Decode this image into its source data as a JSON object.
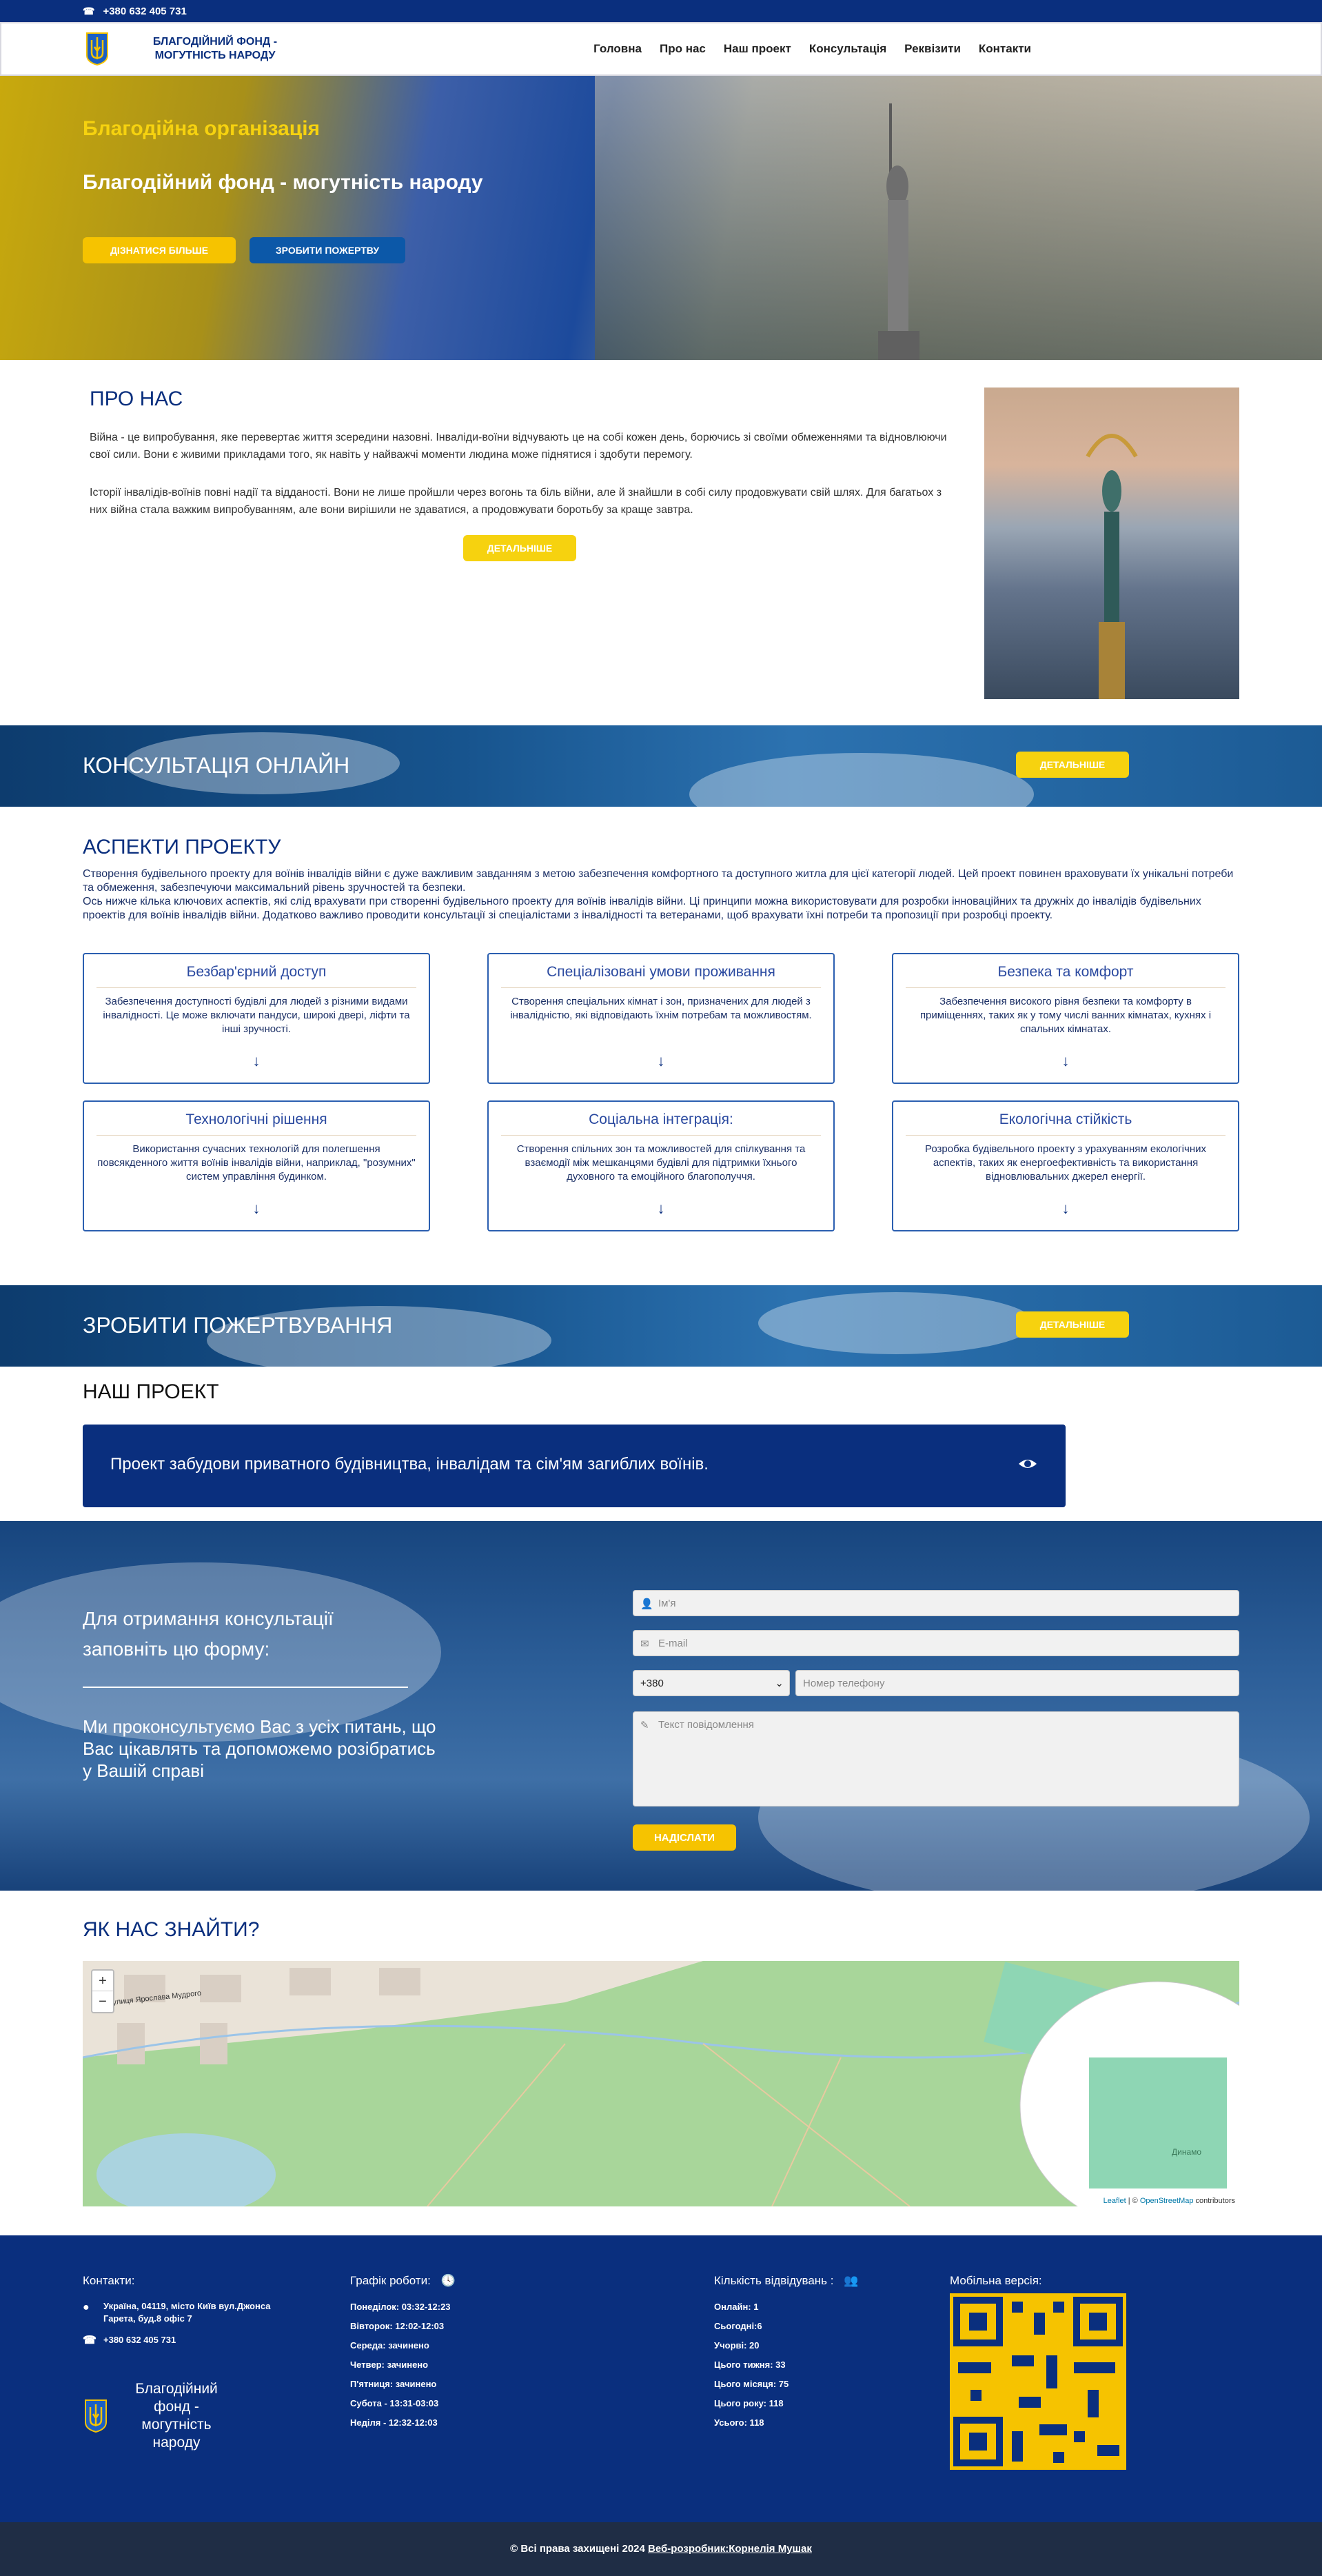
{
  "topbar": {
    "phone": "+380 632 405 731"
  },
  "header": {
    "logo_text": "БЛАГОДІЙНИЙ ФОНД - МОГУТНІСТЬ НАРОДУ",
    "nav": [
      "Головна",
      "Про нас",
      "Наш проект",
      "Консультація",
      "Реквізити",
      "Контакти"
    ]
  },
  "hero": {
    "subtitle": "Благодійна організація",
    "title": "Благодійний фонд - могутність народу",
    "btn_learn": "ДІЗНАТИСЯ БІЛЬШЕ",
    "btn_donate": "ЗРОБИТИ ПОЖЕРТВУ"
  },
  "about": {
    "title": "ПРО НАС",
    "p1": "Війна - це випробування, яке перевертає життя зсередини назовні. Інваліди-воїни відчувають це на собі кожен день, борючись зі своїми обмеженнями та відновлюючи свої сили. Вони є живими прикладами того, як навіть у найважчі моменти людина може піднятися і здобути перемогу.",
    "p2": "Історії інвалідів-воїнів повні надії та відданості. Вони не лише пройшли через вогонь та біль війни, але й знайшли в собі силу продовжувати свій шлях. Для багатьох з них війна стала важким випробуванням, але вони вирішили не здаватися, а продовжувати боротьбу за краще завтра.",
    "btn": "ДЕТАЛЬНІШЕ"
  },
  "consult_banner": {
    "title": "КОНСУЛЬТАЦІЯ ОНЛАЙН",
    "btn": "ДЕТАЛЬНІШЕ"
  },
  "aspects": {
    "title": "АСПЕКТИ ПРОЕКТУ",
    "intro1": "Створення будівельного проекту для воїнів інвалідів війни є дуже важливим завданням з метою забезпечення комфортного та доступного житла для цієї категорії людей. Цей проект повинен враховувати їх унікальні потреби та обмеження, забезпечуючи максимальний рівень зручностей та безпеки.",
    "intro2": "Ось нижче кілька ключових аспектів, які слід врахувати при створенні будівельного проекту для воїнів інвалідів війни. Ці принципи можна використовувати для розробки інноваційних та дружніх до інвалідів будівельних проектів для воїнів інвалідів війни. Додатково важливо проводити консультації зі спеціалістами з інвалідності та ветеранами, щоб врахувати їхні потреби та пропозиції при розробці проекту.",
    "cards": [
      {
        "title": "Безбар'єрний доступ",
        "desc": "Забезпечення доступності будівлі для людей з різними видами інвалідності. Це може включати пандуси, широкі двері, ліфти та інші зручності."
      },
      {
        "title": "Спеціалізовані умови проживання",
        "desc": "Створення спеціальних кімнат і зон, призначених для людей з інвалідністю, які відповідають їхнім потребам та можливостям."
      },
      {
        "title": "Безпека та комфорт",
        "desc": "Забезпечення високого рівня безпеки та комфорту в приміщеннях, таких як у тому числі ванних кімнатах, кухнях і спальних кімнатах."
      },
      {
        "title": "Технологічні рішення",
        "desc": "Використання сучасних технологій для полегшення повсякденного життя воїнів інвалідів війни, наприклад, \"розумних\" систем управління будинком."
      },
      {
        "title": "Соціальна інтеграція:",
        "desc": "Створення спільних зон та можливостей для спілкування та взаємодії між мешканцями будівлі для підтримки їхнього духовного та емоційного благополуччя."
      },
      {
        "title": "Екологічна стійкість",
        "desc": "Розробка будівельного проекту з урахуванням екологічних аспектів, таких як енергоефективність та використання відновлювальних джерел енергії."
      }
    ]
  },
  "donate_banner": {
    "title": "ЗРОБИТИ ПОЖЕРТВУВАННЯ",
    "btn": "ДЕТАЛЬНІШЕ"
  },
  "project": {
    "title": "НАШ ПРОЕКТ",
    "item": "Проект забудови приватного будівництва, інвалідам та сім'ям загиблих воїнів."
  },
  "form": {
    "lead": "Для отримання консультації заповніть цю форму:",
    "text": "Ми проконсультуємо Вас з усіх питань, що Вас цікавлять та допоможемо розібратись у Вашій справі",
    "name_ph": "Ім'я",
    "email_ph": "E-mail",
    "country_code": "+380",
    "phone_ph": "Номер телефону",
    "message_ph": "Текст повідомлення",
    "submit": "НАДІСЛАТИ"
  },
  "map": {
    "title": "ЯК НАС ЗНАЙТИ?",
    "street_label": "Вулиця Ярослава Мудрого",
    "park_label": "Динамо",
    "zoom_in": "+",
    "zoom_out": "−",
    "attrib_leaflet": "Leaflet",
    "attrib_sep": " | © ",
    "attrib_osm": "OpenStreetMap",
    "attrib_tail": " contributors"
  },
  "footer": {
    "contacts_title": "Контакти:",
    "address": "Україна, 04119, місто Київ вул.Джонса Гарета, буд.8 офіс 7",
    "phone": "+380 632 405 731",
    "logo_text": "Благодійний фонд - могутність народу",
    "schedule_title": "Графік роботи:",
    "schedule": [
      "Понеділок: 03:32-12:23",
      "Вівторок: 12:02-12:03",
      "Середа: зачинено",
      "Четвер: зачинено",
      "П'ятниця: зачинено",
      "Субота - 13:31-03:03",
      "Неділя - 12:32-12:03"
    ],
    "visits_title": "Кількість відвідувань :",
    "visits": [
      "Онлайн: 1",
      "Сьогодні:6",
      "Учорві: 20",
      "Цього тижня: 33",
      "Цього місяця: 75",
      "Цього року: 118",
      "Усього: 118"
    ],
    "mobile_title": "Мобільна версія:"
  },
  "copyright": {
    "text": "© Всі права захищені 2024 ",
    "dev": "Веб-розробник:Корнелія Мушак"
  },
  "colors": {
    "brand_blue": "#0a2f7e",
    "accent_yellow": "#f6c300"
  }
}
